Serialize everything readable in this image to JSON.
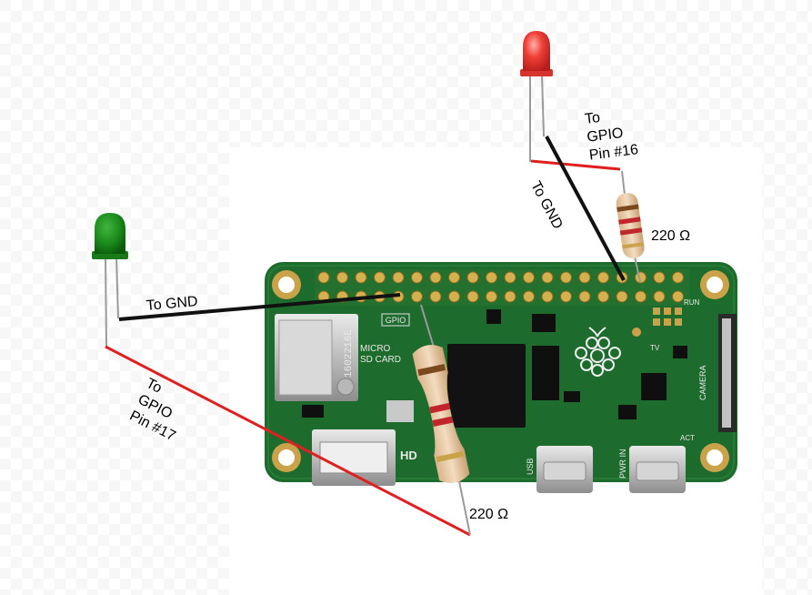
{
  "labels": {
    "red_led_gpio": "To\nGPIO\nPin #16",
    "red_led_gnd": "To GND",
    "red_resistor": "220 Ω",
    "green_led_gnd": "To GND",
    "green_led_gpio": "To\nGPIO\nPin #17",
    "green_resistor": "220 Ω"
  },
  "board": {
    "chip_marking": "1602216E",
    "sd_label": "MICRO\nSD CARD",
    "gpio_tag": "GPIO",
    "usb_label": "USB",
    "pwr_label": "PWR IN",
    "camera_label": "CAMERA",
    "run_label": "RUN",
    "tv_label": "TV",
    "hdmi_label": "HD",
    "act_label": "ACT",
    "j_labels": [
      "J6",
      "J8",
      "J9",
      "J10",
      "J1",
      "J12",
      "L3",
      "U3",
      "L2",
      "U1",
      "U5",
      "X1",
      "Q5"
    ]
  },
  "colors": {
    "board_green": "#1e6b2e",
    "wire_red": "#e02020",
    "wire_black": "#111111",
    "led_red": "#e83030",
    "led_green": "#1a8a1a"
  }
}
